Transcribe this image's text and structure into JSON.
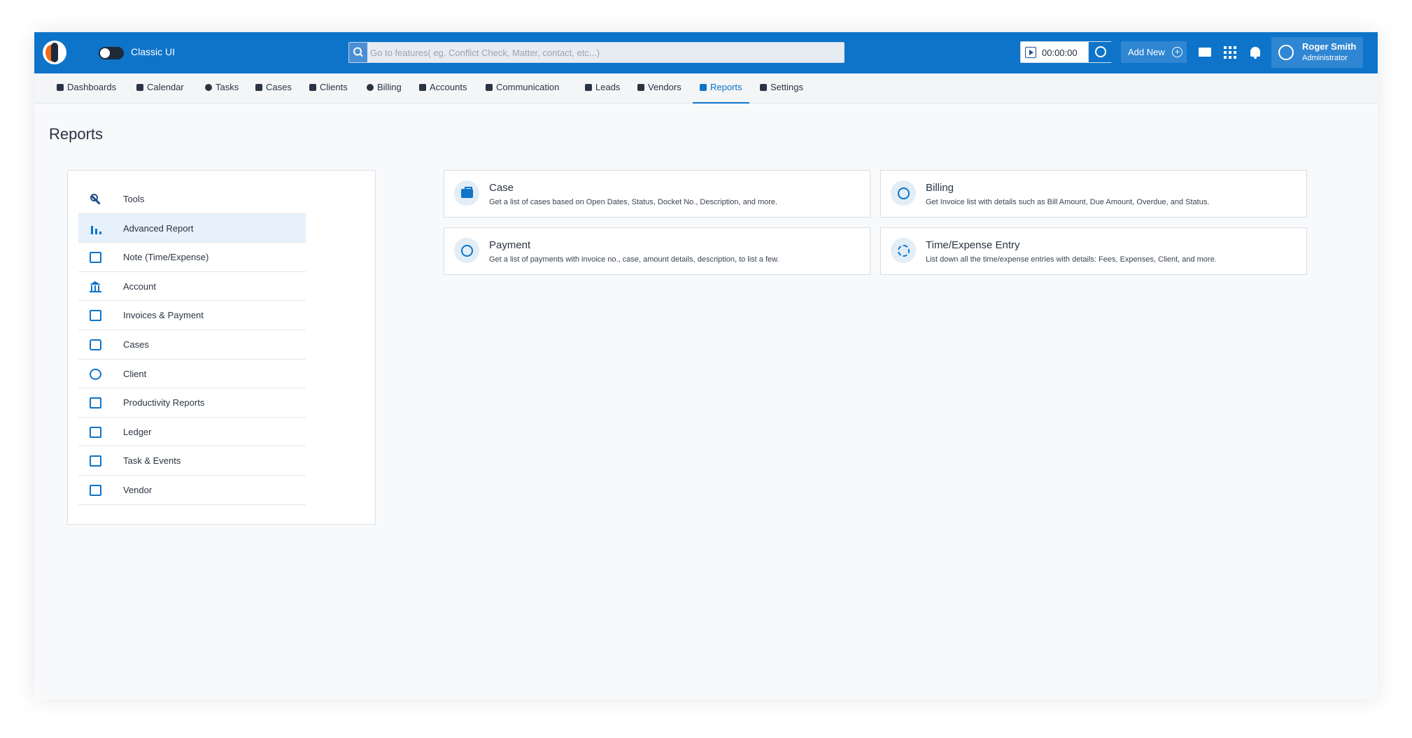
{
  "topbar": {
    "classic_ui_label": "Classic UI",
    "search_placeholder": "Go to features( eg. Conflict Check, Matter, contact, etc...)",
    "timer_value": "00:00:00",
    "add_new_label": "Add New",
    "user_name": "Roger Smith",
    "user_role": "Administrator",
    "brand_color": "#0d74c9"
  },
  "nav": {
    "items": [
      {
        "label": "Dashboards",
        "icon": "grid-icon"
      },
      {
        "label": "Calendar",
        "icon": "calendar-icon"
      },
      {
        "label": "Tasks",
        "icon": "check-circle-icon"
      },
      {
        "label": "Cases",
        "icon": "briefcase-icon"
      },
      {
        "label": "Clients",
        "icon": "people-icon"
      },
      {
        "label": "Billing",
        "icon": "dollar-icon"
      },
      {
        "label": "Accounts",
        "icon": "bank-icon"
      },
      {
        "label": "Communication",
        "icon": "chat-icon"
      },
      {
        "label": "Leads",
        "icon": "leads-icon"
      },
      {
        "label": "Vendors",
        "icon": "store-icon"
      },
      {
        "label": "Reports",
        "icon": "report-icon",
        "active": true
      },
      {
        "label": "Settings",
        "icon": "settings-icon"
      }
    ]
  },
  "page": {
    "title": "Reports"
  },
  "sidebar": {
    "items": [
      {
        "label": "Tools",
        "icon": "wrench-icon"
      },
      {
        "label": "Advanced Report",
        "icon": "bar-chart-icon",
        "active": true
      },
      {
        "label": "Note (Time/Expense)",
        "icon": "note-icon"
      },
      {
        "label": "Account",
        "icon": "bank-icon"
      },
      {
        "label": "Invoices & Payment",
        "icon": "invoice-icon"
      },
      {
        "label": "Cases",
        "icon": "briefcase-icon"
      },
      {
        "label": "Client",
        "icon": "client-icon"
      },
      {
        "label": "Productivity Reports",
        "icon": "productivity-chart-icon"
      },
      {
        "label": "Ledger",
        "icon": "ledger-icon"
      },
      {
        "label": "Task & Events",
        "icon": "calendar-list-icon"
      },
      {
        "label": "Vendor",
        "icon": "vendor-icon"
      }
    ]
  },
  "cards": [
    {
      "title": "Case",
      "desc": "Get a list of cases based on Open Dates, Status, Docket No., Description, and more.",
      "icon": "briefcase-icon"
    },
    {
      "title": "Billing",
      "desc": "Get Invoice list with details such as Bill Amount, Due Amount, Overdue, and Status.",
      "icon": "dollar-circle-icon"
    },
    {
      "title": "Payment",
      "desc": "Get a list of payments with invoice no., case, amount details, description, to list a few.",
      "icon": "dollar-circle-icon"
    },
    {
      "title": "Time/Expense Entry",
      "desc": "List down all the time/expense entries with details: Fees, Expenses, Client, and more.",
      "icon": "time-dollar-icon"
    }
  ]
}
